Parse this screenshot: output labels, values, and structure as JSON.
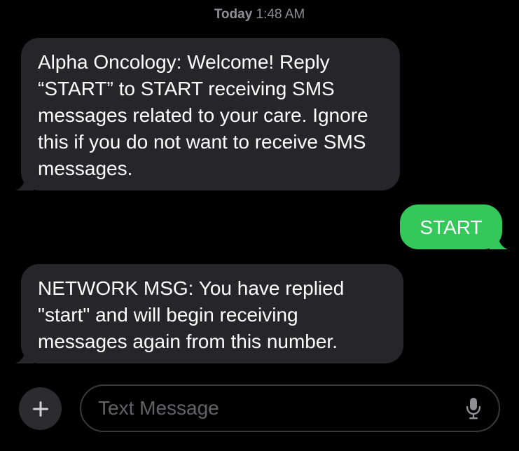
{
  "header": {
    "timestamp_day": "Today",
    "timestamp_time": "1:48 AM"
  },
  "messages": [
    {
      "direction": "received",
      "text": "Alpha Oncology: Welcome! Reply “START” to START receiving SMS messages related to your care. Ignore this if you do not want to receive SMS messages."
    },
    {
      "direction": "sent",
      "text": "START"
    },
    {
      "direction": "received",
      "text": "NETWORK MSG: You have replied \"start\" and will begin receiving messages again from this number."
    }
  ],
  "composer": {
    "add_icon": "plus-icon",
    "placeholder": "Text Message",
    "mic_icon": "microphone-icon"
  },
  "colors": {
    "background": "#000000",
    "received_bubble": "#262628",
    "sent_bubble": "#34c759",
    "timestamp": "#8e8e93",
    "placeholder": "#636366"
  }
}
